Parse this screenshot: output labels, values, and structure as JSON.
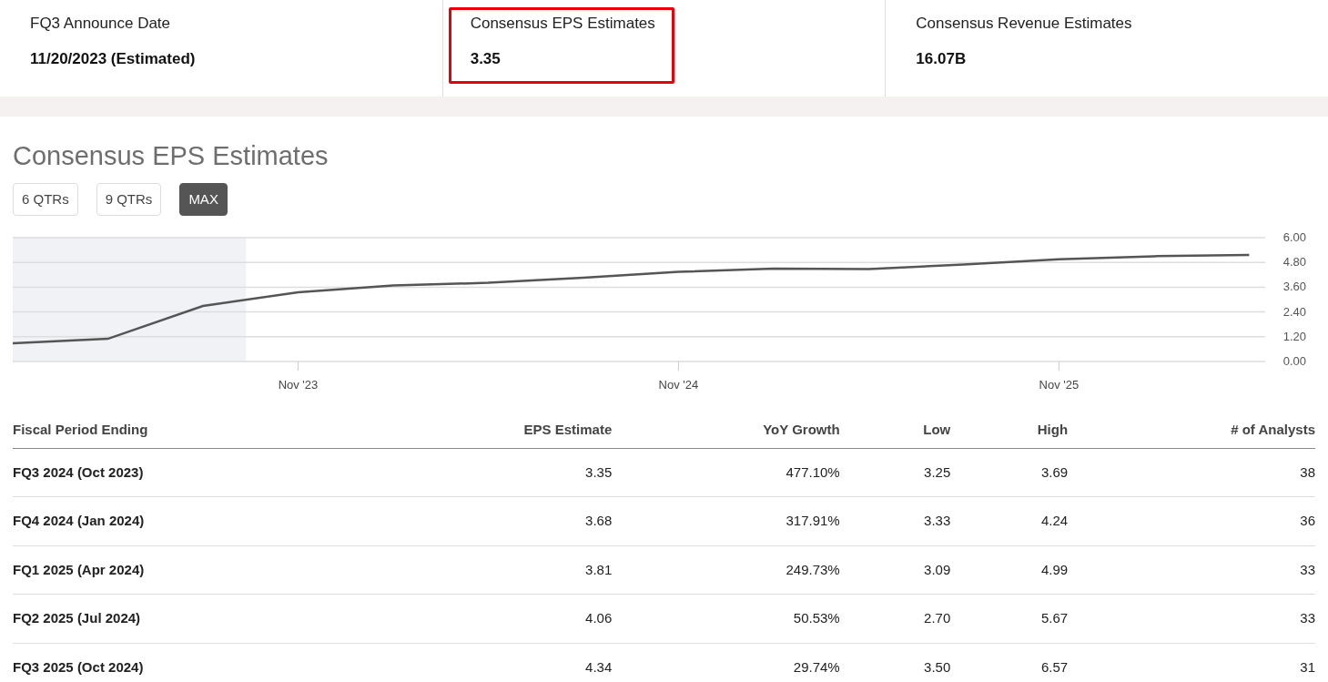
{
  "summary": [
    {
      "label": "FQ3 Announce Date",
      "value": "11/20/2023 (Estimated)",
      "highlighted": false
    },
    {
      "label": "Consensus EPS Estimates",
      "value": "3.35",
      "highlighted": true
    },
    {
      "label": "Consensus Revenue Estimates",
      "value": "16.07B",
      "highlighted": false
    }
  ],
  "section_title": "Consensus EPS Estimates",
  "range_buttons": [
    {
      "label": "6 QTRs",
      "selected": false
    },
    {
      "label": "9 QTRs",
      "selected": false
    },
    {
      "label": "MAX",
      "selected": true
    }
  ],
  "chart_data": {
    "type": "line",
    "categories": [
      null,
      null,
      null,
      "Nov '23",
      null,
      null,
      null,
      "Nov '24",
      null,
      null,
      null,
      "Nov '25",
      null,
      null
    ],
    "series": [
      {
        "color": "#555555",
        "values": [
          0.88,
          1.1,
          2.69,
          3.35,
          3.68,
          3.81,
          4.06,
          4.34,
          4.5,
          4.48,
          4.7,
          4.95,
          5.1,
          5.16
        ]
      }
    ],
    "ylim": [
      0,
      6
    ],
    "yticks": [
      {
        "value": 0,
        "label": "0.00"
      },
      {
        "value": 1.2,
        "label": "1.20"
      },
      {
        "value": 2.4,
        "label": "2.40"
      },
      {
        "value": 3.6,
        "label": "3.60"
      },
      {
        "value": 4.8,
        "label": "4.80"
      },
      {
        "value": 6,
        "label": "6.00"
      }
    ],
    "grid": true
  },
  "table": {
    "columns": [
      "Fiscal Period Ending",
      "EPS Estimate",
      "YoY Growth",
      "Low",
      "High",
      "# of Analysts"
    ],
    "rows": [
      [
        "FQ3 2024 (Oct 2023)",
        "3.35",
        "477.10%",
        "3.25",
        "3.69",
        "38"
      ],
      [
        "FQ4 2024 (Jan 2024)",
        "3.68",
        "317.91%",
        "3.33",
        "4.24",
        "36"
      ],
      [
        "FQ1 2025 (Apr 2024)",
        "3.81",
        "249.73%",
        "3.09",
        "4.99",
        "33"
      ],
      [
        "FQ2 2025 (Jul 2024)",
        "4.06",
        "50.53%",
        "2.70",
        "5.67",
        "33"
      ],
      [
        "FQ3 2025 (Oct 2024)",
        "4.34",
        "29.74%",
        "3.50",
        "6.57",
        "31"
      ]
    ]
  }
}
